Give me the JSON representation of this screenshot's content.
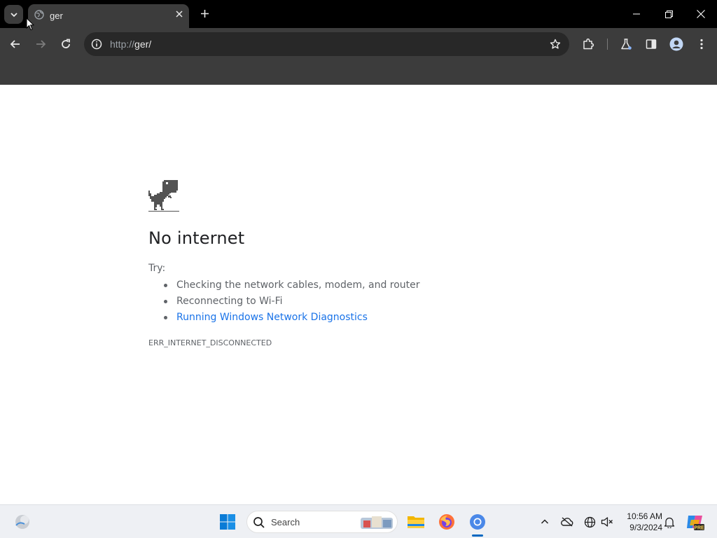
{
  "browser": {
    "tab": {
      "title": "ger"
    },
    "address_bar": {
      "url_scheme": "http://",
      "url_host": "ger/"
    }
  },
  "page": {
    "title": "No internet",
    "try_label": "Try:",
    "suggestions": [
      "Checking the network cables, modem, and router",
      "Reconnecting to Wi-Fi",
      "Running Windows Network Diagnostics"
    ],
    "error_code": "ERR_INTERNET_DISCONNECTED"
  },
  "taskbar": {
    "search_placeholder": "Search",
    "time": "10:56 AM",
    "date": "9/3/2024",
    "pinned_apps": [
      "file-explorer-icon",
      "firefox-icon",
      "chrome-icon"
    ]
  },
  "colors": {
    "titlebar": "#000000",
    "toolbar": "#3c3c3c",
    "link": "#1a73e8",
    "taskbar": "#eef0f4"
  }
}
